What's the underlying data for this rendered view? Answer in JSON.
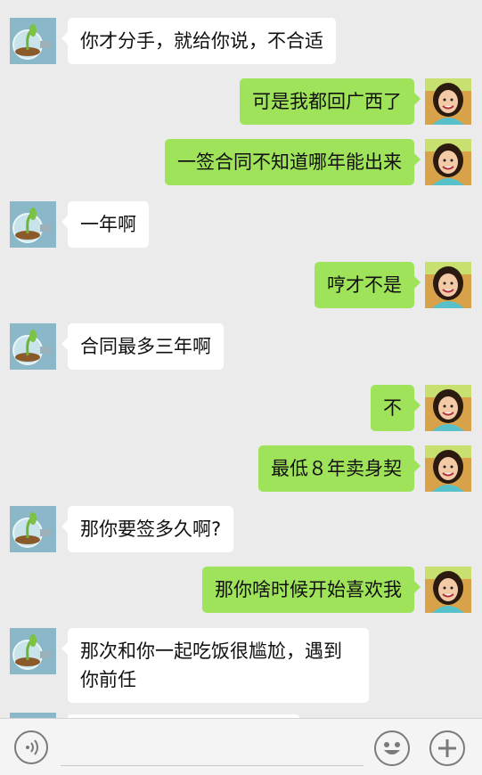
{
  "messages": [
    {
      "side": "in",
      "text": "你才分手，就给你说，不合适"
    },
    {
      "side": "out",
      "text": "可是我都回广西了"
    },
    {
      "side": "out",
      "text": "一签合同不知道哪年能出来"
    },
    {
      "side": "in",
      "text": "一年啊"
    },
    {
      "side": "out",
      "text": "哼才不是"
    },
    {
      "side": "in",
      "text": "合同最多三年啊"
    },
    {
      "side": "out",
      "text": "不"
    },
    {
      "side": "out",
      "text": "最低８年卖身契"
    },
    {
      "side": "in",
      "text": "那你要签多久啊?"
    },
    {
      "side": "out",
      "text": "那你啥时候开始喜欢我"
    },
    {
      "side": "in",
      "text": "那次和你一起吃饭很尴尬，遇到你前任"
    }
  ],
  "avatars": {
    "contact": "bulb-sprout-avatar",
    "self": "girl-scarf-avatar"
  },
  "input_bar": {
    "voice_icon": "voice-icon",
    "emoji_icon": "emoji-icon",
    "plus_icon": "plus-icon",
    "text_value": ""
  },
  "colors": {
    "background": "#ebebeb",
    "outgoing_bubble": "#9fe35a",
    "incoming_bubble": "#ffffff"
  }
}
